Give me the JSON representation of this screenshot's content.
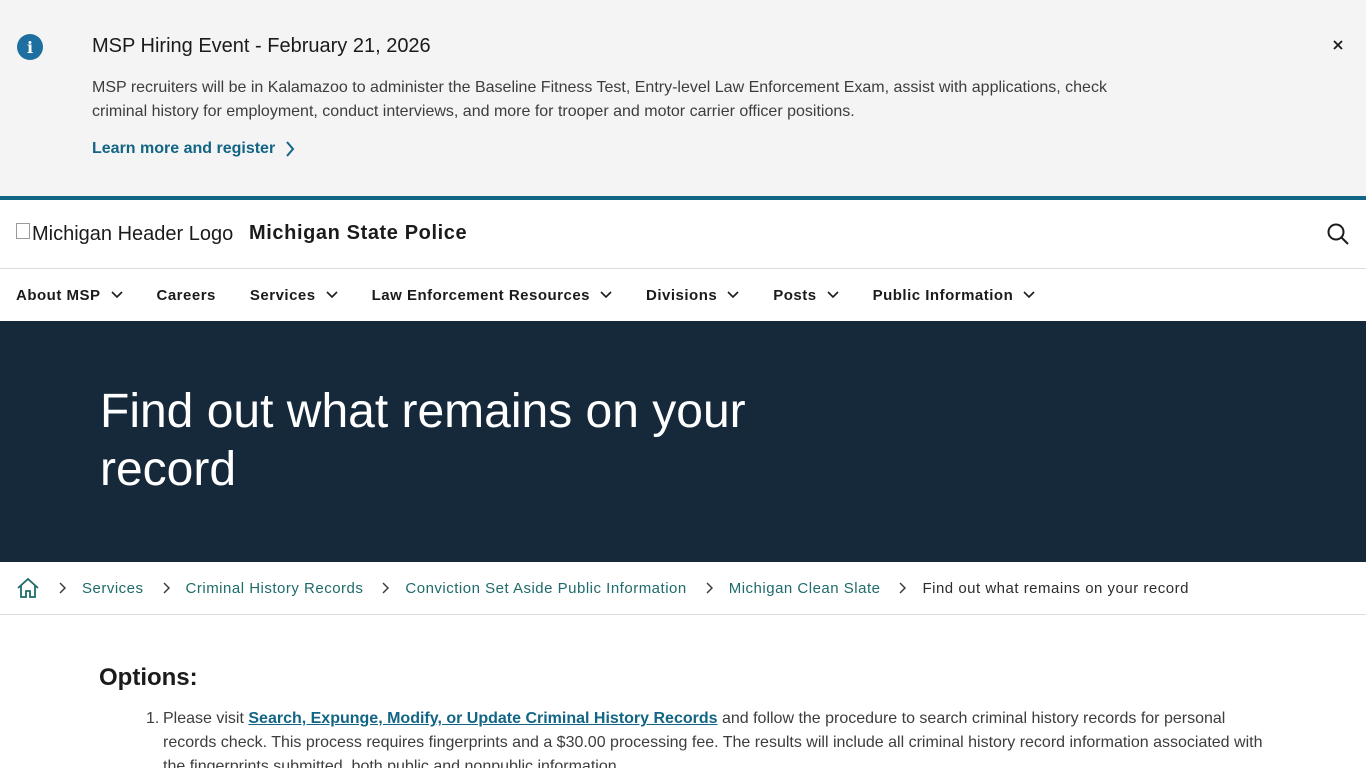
{
  "alert": {
    "icon": "info-icon",
    "title": "MSP Hiring Event - February 21, 2026",
    "body": "MSP recruiters will be in Kalamazoo to administer the Baseline Fitness Test, Entry-level Law Enforcement Exam, assist with applications, check criminal history for employment, conduct interviews, and more for trooper and motor carrier officer positions.",
    "link_label": "Learn more and register",
    "close_glyph": "×"
  },
  "header": {
    "logo_alt": "Michigan Header Logo",
    "site_name": "Michigan State Police",
    "search_icon": "search-icon"
  },
  "nav": {
    "items": [
      {
        "label": "About MSP",
        "has_dropdown": true
      },
      {
        "label": "Careers",
        "has_dropdown": false
      },
      {
        "label": "Services",
        "has_dropdown": true
      },
      {
        "label": "Law Enforcement Resources",
        "has_dropdown": true
      },
      {
        "label": "Divisions",
        "has_dropdown": true
      },
      {
        "label": "Posts",
        "has_dropdown": true
      },
      {
        "label": "Public Information",
        "has_dropdown": true
      }
    ]
  },
  "hero": {
    "title": "Find out what remains on your record"
  },
  "breadcrumb": {
    "home_icon": "home-icon",
    "links": [
      "Services",
      "Criminal History Records",
      "Conviction Set Aside Public Information",
      "Michigan Clean Slate"
    ],
    "current": "Find out what remains on your record"
  },
  "main": {
    "heading": "Options:",
    "items": [
      {
        "number": "1.",
        "prefix": "Please visit ",
        "link": "Search, Expunge, Modify, or Update Criminal History Records",
        "suffix": " and follow the procedure to search criminal history records for personal records check. This process requires fingerprints and a $30.00 processing fee. The results will include all criminal history record information associated with the fingerprints submitted, both public and nonpublic information."
      }
    ]
  },
  "colors": {
    "accent": "#136585",
    "hero_bg": "#15293b",
    "alert_bg": "#f4f4f4",
    "breadcrumb_link": "#1f6b6b"
  }
}
